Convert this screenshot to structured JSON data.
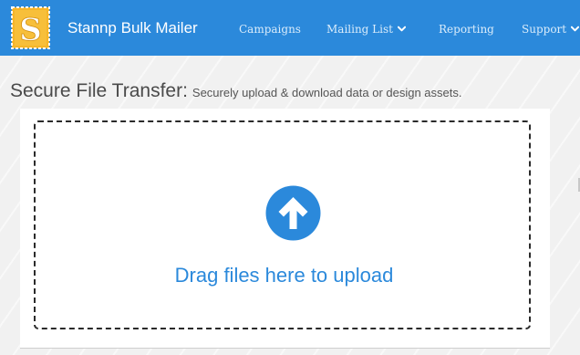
{
  "navbar": {
    "brand_logo_letter": "S",
    "brand_name": "Stannp Bulk Mailer",
    "links": [
      {
        "label": "Campaigns"
      },
      {
        "label": "Mailing List",
        "has_dropdown": true
      },
      {
        "label": "Reporting"
      },
      {
        "label": "Support",
        "has_dropdown": true
      }
    ]
  },
  "page": {
    "title": "Secure File Transfer:",
    "subtitle": "Securely upload & download data or design assets."
  },
  "dropzone": {
    "icon": "arrow-up-circle-icon",
    "label": "Drag files here to upload"
  },
  "colors": {
    "navbar_bg": "#2b89db",
    "accent": "#2b89db",
    "logo_bg": "#f5b52a"
  }
}
